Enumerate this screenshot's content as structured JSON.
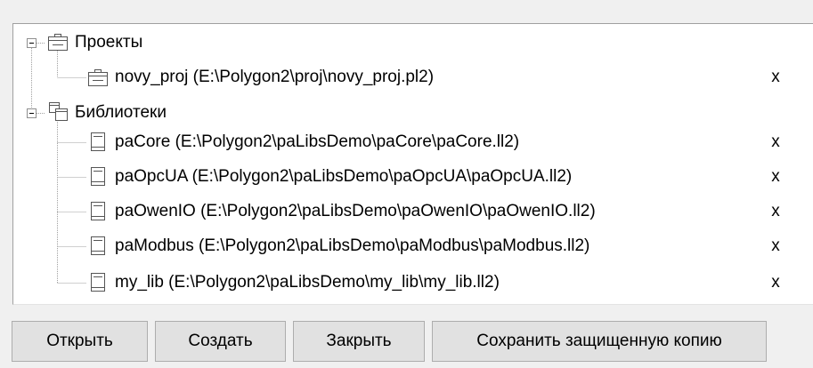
{
  "tree": {
    "projects": {
      "label": "Проекты",
      "items": [
        {
          "label": "novy_proj (E:\\Polygon2\\proj\\novy_proj.pl2)",
          "remove": "x"
        }
      ]
    },
    "libraries": {
      "label": "Библиотеки",
      "items": [
        {
          "label": "paCore (E:\\Polygon2\\paLibsDemo\\paCore\\paCore.ll2)",
          "remove": "x"
        },
        {
          "label": "paOpcUA (E:\\Polygon2\\paLibsDemo\\paOpcUA\\paOpcUA.ll2)",
          "remove": "x"
        },
        {
          "label": "paOwenIO (E:\\Polygon2\\paLibsDemo\\paOwenIO\\paOwenIO.ll2)",
          "remove": "x"
        },
        {
          "label": "paModbus (E:\\Polygon2\\paLibsDemo\\paModbus\\paModbus.ll2)",
          "remove": "x"
        },
        {
          "label": "my_lib (E:\\Polygon2\\paLibsDemo\\my_lib\\my_lib.ll2)",
          "remove": "x"
        }
      ]
    }
  },
  "buttons": {
    "open": "Открыть",
    "create": "Создать",
    "close": "Закрыть",
    "save_protected": "Сохранить защищенную копию"
  },
  "icons": {
    "project": "project-folder-icon",
    "libraries": "libraries-icon",
    "library": "library-book-icon"
  }
}
